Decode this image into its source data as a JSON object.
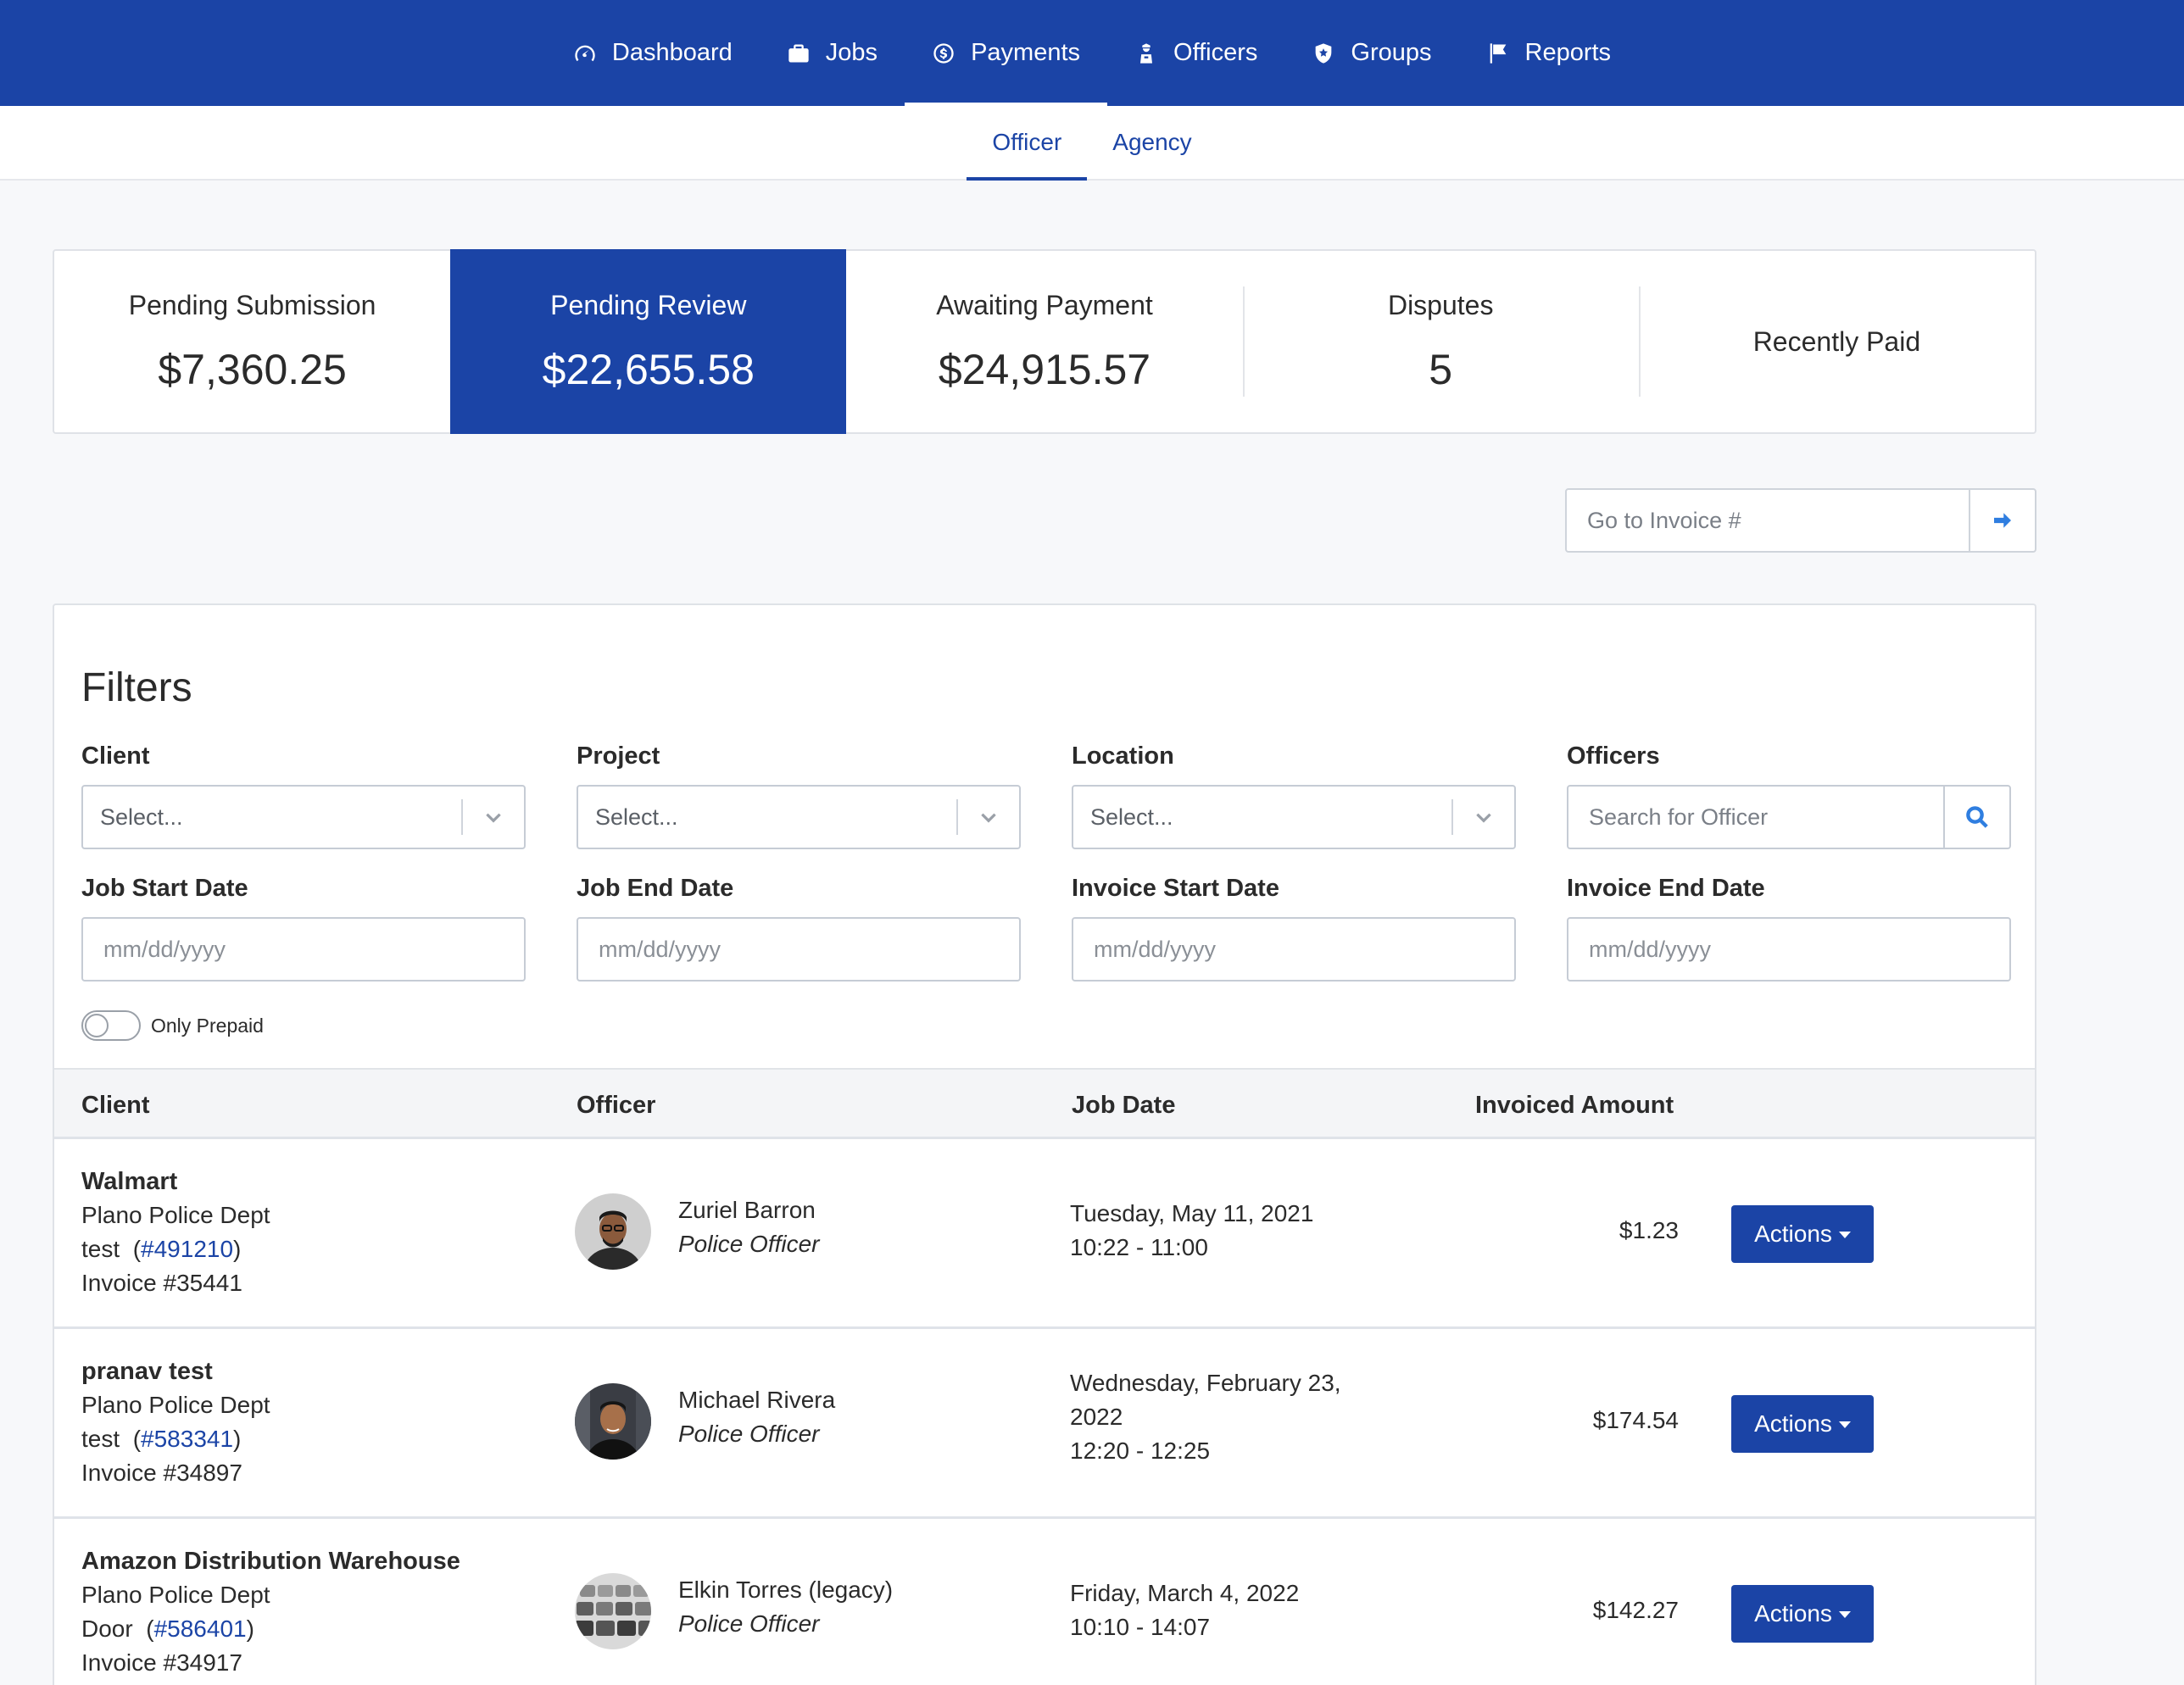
{
  "nav": {
    "items": [
      {
        "label": "Dashboard",
        "icon": "gauge-icon"
      },
      {
        "label": "Jobs",
        "icon": "briefcase-icon"
      },
      {
        "label": "Payments",
        "icon": "dollar-circle-icon",
        "active": true
      },
      {
        "label": "Officers",
        "icon": "officer-icon"
      },
      {
        "label": "Groups",
        "icon": "shield-icon"
      },
      {
        "label": "Reports",
        "icon": "flag-icon"
      }
    ]
  },
  "subnav": {
    "items": [
      {
        "label": "Officer",
        "active": true
      },
      {
        "label": "Agency"
      }
    ]
  },
  "summary": {
    "cards": [
      {
        "label": "Pending Submission",
        "value": "$7,360.25"
      },
      {
        "label": "Pending Review",
        "value": "$22,655.58",
        "active": true
      },
      {
        "label": "Awaiting Payment",
        "value": "$24,915.57"
      },
      {
        "label": "Disputes",
        "value": "5"
      },
      {
        "label": "Recently Paid",
        "value": ""
      }
    ]
  },
  "goto": {
    "placeholder": "Go to Invoice #",
    "icon": "arrow-right-icon"
  },
  "filters": {
    "title": "Filters",
    "client": {
      "label": "Client",
      "placeholder": "Select..."
    },
    "project": {
      "label": "Project",
      "placeholder": "Select..."
    },
    "location": {
      "label": "Location",
      "placeholder": "Select..."
    },
    "officers": {
      "label": "Officers",
      "placeholder": "Search for Officer"
    },
    "job_start": {
      "label": "Job Start Date",
      "placeholder": "mm/dd/yyyy"
    },
    "job_end": {
      "label": "Job End Date",
      "placeholder": "mm/dd/yyyy"
    },
    "invoice_start": {
      "label": "Invoice Start Date",
      "placeholder": "mm/dd/yyyy"
    },
    "invoice_end": {
      "label": "Invoice End Date",
      "placeholder": "mm/dd/yyyy"
    },
    "prepaid": {
      "label": "Only Prepaid",
      "on": false
    }
  },
  "table": {
    "headers": {
      "client": "Client",
      "officer": "Officer",
      "job_date": "Job Date",
      "amount": "Invoiced Amount"
    },
    "actions_label": "Actions",
    "rows": [
      {
        "client": "Walmart",
        "agency": "Plano Police Dept",
        "project_prefix": "test",
        "project_id": "#491210",
        "invoice": "Invoice #35441",
        "officer_name": "Zuriel Barron",
        "officer_role": "Police Officer",
        "date_line1": "Tuesday, May 11, 2021",
        "date_line2": "10:22 - 11:00",
        "amount": "$1.23"
      },
      {
        "client": "pranav test",
        "agency": "Plano Police Dept",
        "project_prefix": "test",
        "project_id": "#583341",
        "invoice": "Invoice #34897",
        "officer_name": "Michael Rivera",
        "officer_role": "Police Officer",
        "date_line1": "Wednesday, February 23, 2022",
        "date_line2": "12:20 - 12:25",
        "amount": "$174.54"
      },
      {
        "client": "Amazon Distribution Warehouse",
        "agency": "Plano Police Dept",
        "project_prefix": "Door",
        "project_id": "#586401",
        "invoice": "Invoice #34917",
        "officer_name": "Elkin Torres (legacy)",
        "officer_role": "Police Officer",
        "date_line1": "Friday, March 4, 2022",
        "date_line2": "10:10 - 14:07",
        "amount": "$142.27"
      }
    ]
  }
}
